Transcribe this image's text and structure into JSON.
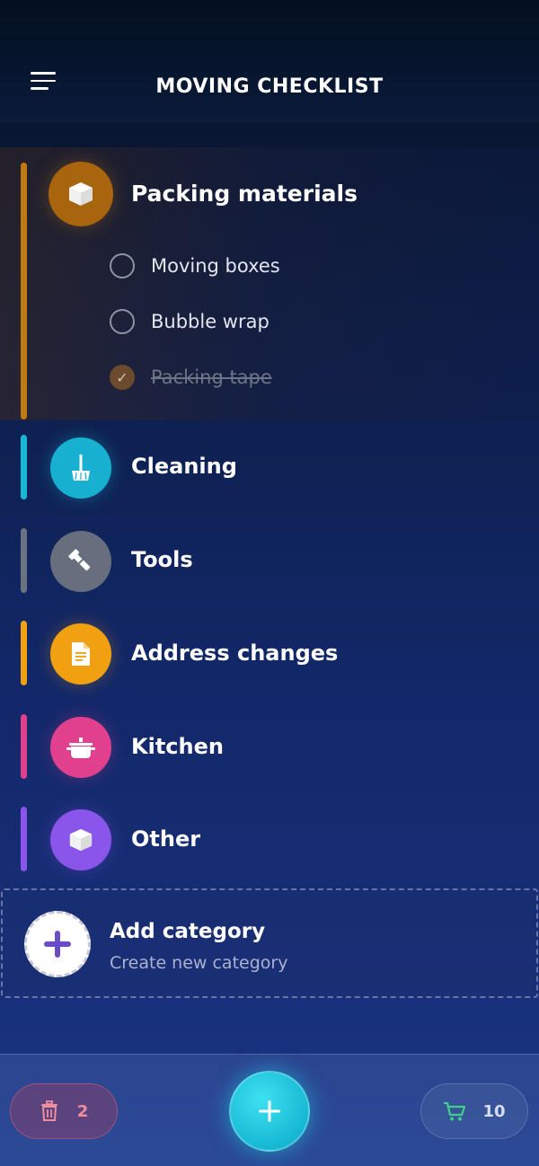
{
  "header": {
    "title": "MOVING CHECKLIST"
  },
  "categories": [
    {
      "label": "Packing materials",
      "color": "#c07a14",
      "icon": "box-icon",
      "expanded": true,
      "tasks": [
        {
          "text": "Moving boxes",
          "done": false
        },
        {
          "text": "Bubble wrap",
          "done": false
        },
        {
          "text": "Packing tape",
          "done": true
        }
      ]
    },
    {
      "label": "Cleaning",
      "color": "#17b8d4",
      "icon": "broom-icon"
    },
    {
      "label": "Tools",
      "color": "#6b7282",
      "icon": "wrench-icon"
    },
    {
      "label": "Address changes",
      "color": "#f0a010",
      "icon": "document-icon"
    },
    {
      "label": "Kitchen",
      "color": "#e0408e",
      "icon": "pot-icon"
    },
    {
      "label": "Other",
      "color": "#8a55ea",
      "icon": "box-icon"
    }
  ],
  "add_category": {
    "title": "Add category",
    "subtitle": "Create new category"
  },
  "bottom_bar": {
    "trash_count": "2",
    "cart_count": "10"
  }
}
